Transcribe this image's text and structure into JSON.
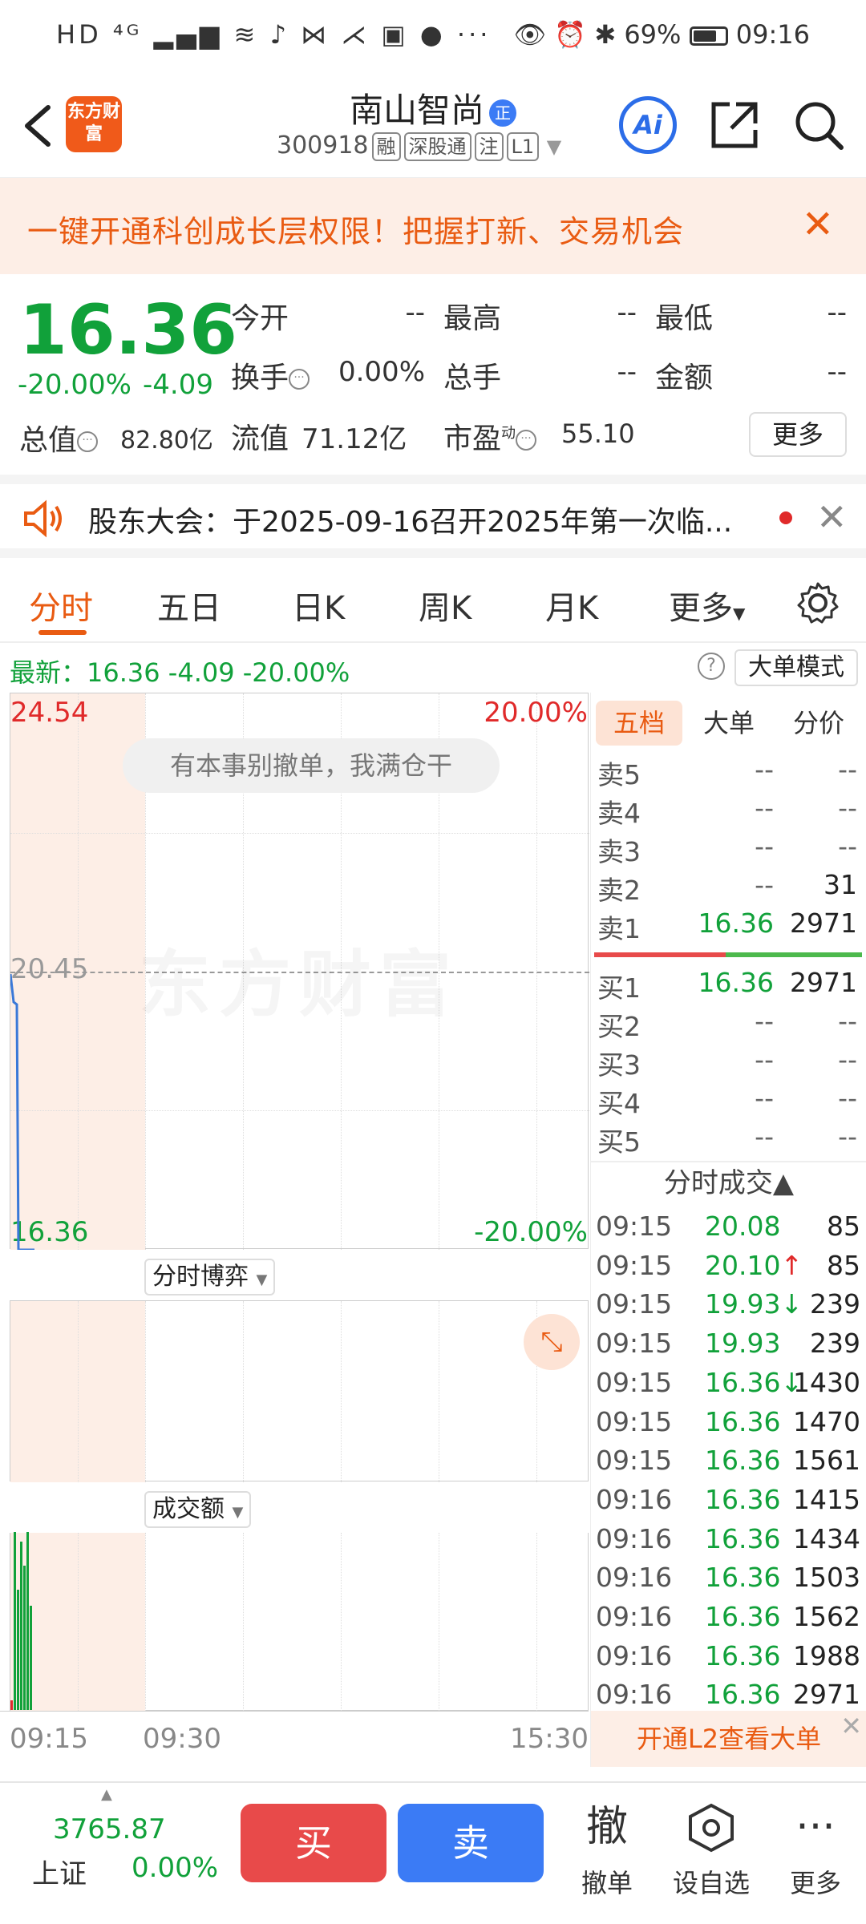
{
  "status_bar": {
    "left_icons": "HD ⁴ᴳ ▂▄▆ ≋ ♪ ⋈ ⋌ ▣ ● ···",
    "battery": "69%",
    "time": "09:16"
  },
  "header": {
    "logo_text": "东方财富",
    "stock_name": "南山智尚",
    "stock_tag": "正",
    "stock_code": "300918",
    "badges": [
      "融",
      "深股通",
      "注",
      "L1"
    ],
    "ai_label": "Ai"
  },
  "promo": {
    "text": "一键开通科创成长层权限！把握打新、交易机会"
  },
  "quote": {
    "price": "16.36",
    "pct": "-20.00%",
    "chg": "-4.09",
    "open_label": "今开",
    "open_val": "--",
    "high_label": "最高",
    "high_val": "--",
    "low_label": "最低",
    "low_val": "--",
    "turnover_label": "换手",
    "turnover_val": "0.00%",
    "vol_label": "总手",
    "vol_val": "--",
    "amount_label": "金额",
    "amount_val": "--",
    "mktcap_label": "总值",
    "mktcap_val": "82.80亿",
    "float_label": "流值",
    "float_val": "71.12亿",
    "pe_label": "市盈",
    "pe_sup": "动",
    "pe_val": "55.10",
    "more_label": "更多"
  },
  "announcement": {
    "text": "股东大会：于2025-09-16召开2025年第一次临..."
  },
  "tabs": [
    "分时",
    "五日",
    "日K",
    "周K",
    "月K",
    "更多"
  ],
  "latest": {
    "text": "最新：16.36  -4.09  -20.00%",
    "help": "?",
    "mode_label": "大单模式"
  },
  "chart": {
    "watermark": "东方财富",
    "tip": "有本事别撤单，我满仓干",
    "y_top": "24.54",
    "y_mid": "20.45",
    "y_bot": "16.36",
    "pct_top": "20.00%",
    "pct_bot": "-20.00%",
    "sub1_label": "分时博弈",
    "sub2_label": "成交额",
    "time_start": "09:15",
    "time_mid": "09:30",
    "time_end": "15:30"
  },
  "order_book": {
    "tabs": [
      "五档",
      "大单",
      "分价"
    ],
    "asks": [
      {
        "label": "卖5",
        "price": "--",
        "vol": "--"
      },
      {
        "label": "卖4",
        "price": "--",
        "vol": "--"
      },
      {
        "label": "卖3",
        "price": "--",
        "vol": "--"
      },
      {
        "label": "卖2",
        "price": "--",
        "vol": "31"
      },
      {
        "label": "卖1",
        "price": "16.36",
        "vol": "2971"
      }
    ],
    "bids": [
      {
        "label": "买1",
        "price": "16.36",
        "vol": "2971"
      },
      {
        "label": "买2",
        "price": "--",
        "vol": "--"
      },
      {
        "label": "买3",
        "price": "--",
        "vol": "--"
      },
      {
        "label": "买4",
        "price": "--",
        "vol": "--"
      },
      {
        "label": "买5",
        "price": "--",
        "vol": "--"
      }
    ],
    "trades_title": "分时成交▲",
    "trades": [
      {
        "time": "09:15",
        "price": "20.08",
        "vol": "85"
      },
      {
        "time": "09:15",
        "price": "20.10↑",
        "vol": "85"
      },
      {
        "time": "09:15",
        "price": "19.93↓",
        "vol": "239"
      },
      {
        "time": "09:15",
        "price": "19.93",
        "vol": "239"
      },
      {
        "time": "09:15",
        "price": "16.36↓",
        "vol": "1430"
      },
      {
        "time": "09:15",
        "price": "16.36",
        "vol": "1470"
      },
      {
        "time": "09:15",
        "price": "16.36",
        "vol": "1561"
      },
      {
        "time": "09:16",
        "price": "16.36",
        "vol": "1415"
      },
      {
        "time": "09:16",
        "price": "16.36",
        "vol": "1434"
      },
      {
        "time": "09:16",
        "price": "16.36",
        "vol": "1503"
      },
      {
        "time": "09:16",
        "price": "16.36",
        "vol": "1562"
      },
      {
        "time": "09:16",
        "price": "16.36",
        "vol": "1988"
      },
      {
        "time": "09:16",
        "price": "16.36",
        "vol": "2971"
      }
    ],
    "l2_banner": "开通L2查看大单"
  },
  "bottom": {
    "index_value": "3765.87",
    "index_name": "上证",
    "index_pct": "0.00%",
    "buy_label": "买",
    "sell_label": "卖",
    "cancel_icon": "撤",
    "cancel_label": "撤单",
    "watch_label": "设自选",
    "more_label": "更多"
  }
}
